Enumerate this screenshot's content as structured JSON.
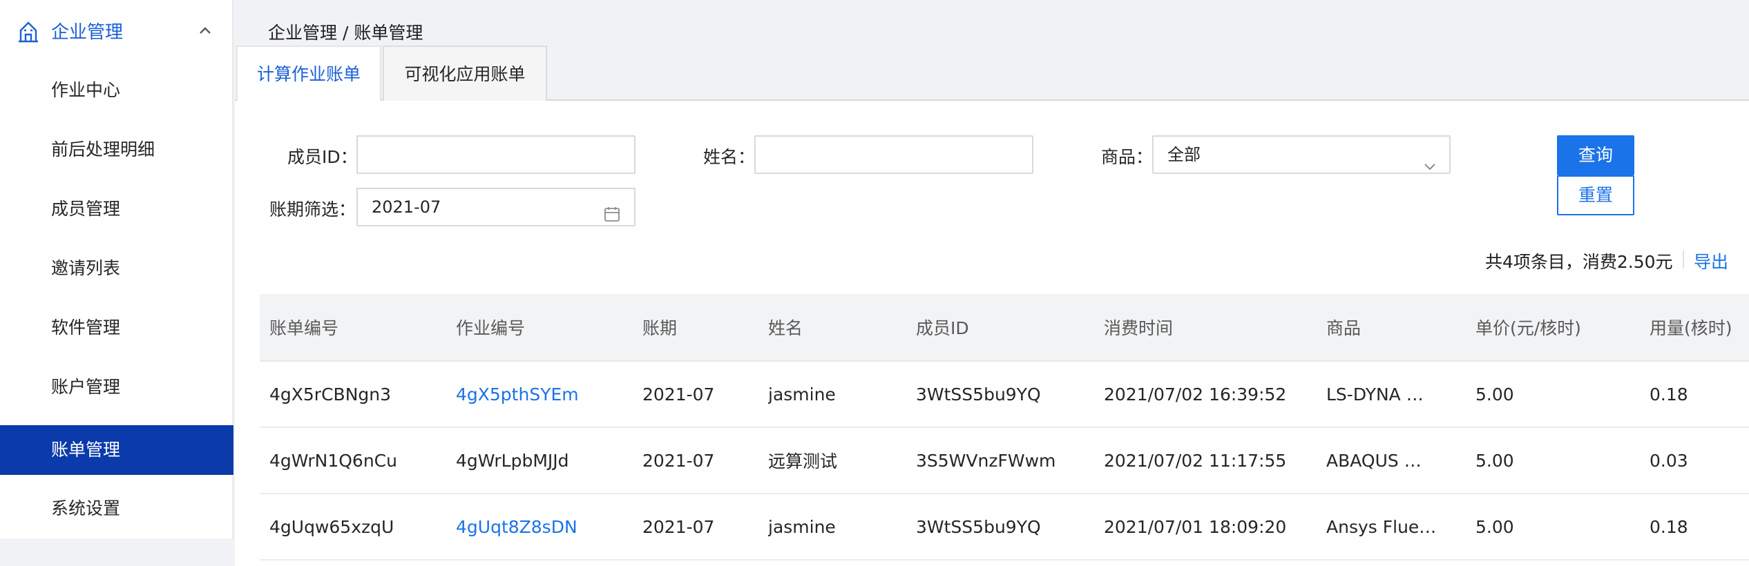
{
  "sidebar": {
    "group": {
      "label": "企业管理"
    },
    "items": [
      {
        "label": "作业中心"
      },
      {
        "label": "前后处理明细"
      },
      {
        "label": "成员管理"
      },
      {
        "label": "邀请列表"
      },
      {
        "label": "软件管理"
      },
      {
        "label": "账户管理"
      },
      {
        "label": "账单管理",
        "active": true
      },
      {
        "label": "系统设置"
      }
    ]
  },
  "breadcrumb": "企业管理 / 账单管理",
  "tabs": [
    {
      "label": "计算作业账单",
      "active": true
    },
    {
      "label": "可视化应用账单"
    }
  ],
  "filters": {
    "member_id_label": "成员ID：",
    "member_id_value": "",
    "name_label": "姓名：",
    "name_value": "",
    "product_label": "商品：",
    "product_value": "全部",
    "period_label": "账期筛选：",
    "period_value": "2021-07",
    "query_button": "查询",
    "reset_button": "重置"
  },
  "summary": {
    "text": "共4项条目，消费2.50元",
    "export": "导出"
  },
  "table": {
    "headers": [
      "账单编号",
      "作业编号",
      "账期",
      "姓名",
      "成员ID",
      "消费时间",
      "商品",
      "单价(元/核时)",
      "用量(核时)"
    ],
    "rows": [
      {
        "bill_id": "4gX5rCBNgn3",
        "job_id": "4gX5pthSYEm",
        "job_link": true,
        "period": "2021-07",
        "name": "jasmine",
        "member_id": "3WtSS5bu9YQ",
        "time": "2021/07/02 16:39:52",
        "product": "LS-DYNA …",
        "price": "5.00",
        "usage": "0.18"
      },
      {
        "bill_id": "4gWrN1Q6nCu",
        "job_id": "4gWrLpbMJJd",
        "job_link": false,
        "period": "2021-07",
        "name": "远算测试",
        "member_id": "3S5WVnzFWwm",
        "time": "2021/07/02 11:17:55",
        "product": "ABAQUS …",
        "price": "5.00",
        "usage": "0.03"
      },
      {
        "bill_id": "4gUqw65xzqU",
        "job_id": "4gUqt8Z8sDN",
        "job_link": true,
        "period": "2021-07",
        "name": "jasmine",
        "member_id": "3WtSS5bu9YQ",
        "time": "2021/07/01 18:09:20",
        "product": "Ansys Flue…",
        "price": "5.00",
        "usage": "0.18"
      }
    ]
  },
  "colors": {
    "accent": "#1a73e8",
    "sidebar_active": "#0b3aab"
  },
  "icons": {
    "group": "building-icon",
    "collapse": "chevron-up-icon",
    "select": "chevron-down-icon",
    "calendar": "calendar-icon"
  }
}
